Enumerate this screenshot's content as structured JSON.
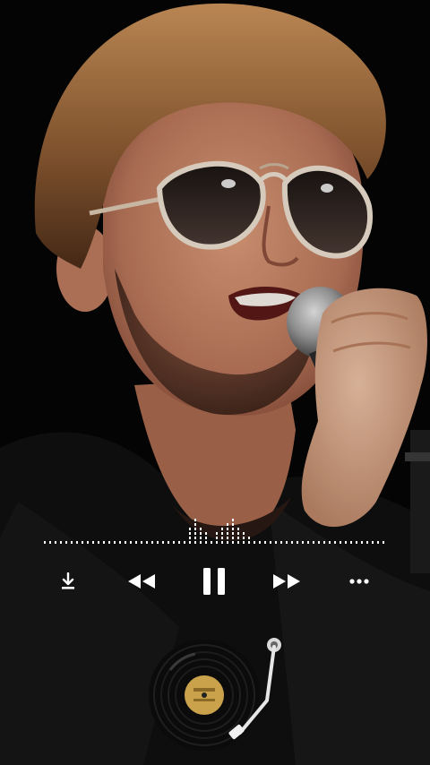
{
  "player": {
    "controls": [
      {
        "name": "download-button",
        "icon": "download-icon"
      },
      {
        "name": "previous-button",
        "icon": "rewind-icon"
      },
      {
        "name": "pause-button",
        "icon": "pause-icon"
      },
      {
        "name": "next-button",
        "icon": "fast-forward-icon"
      },
      {
        "name": "more-button",
        "icon": "more-dots-icon"
      }
    ],
    "artwork": {
      "subject": "singer-with-microphone",
      "record_icon": "vinyl-record-icon",
      "tonearm_icon": "tonearm-icon"
    },
    "colors": {
      "icon": "#FFFFFF",
      "background": "#000000",
      "label": "#C9A24B"
    }
  }
}
